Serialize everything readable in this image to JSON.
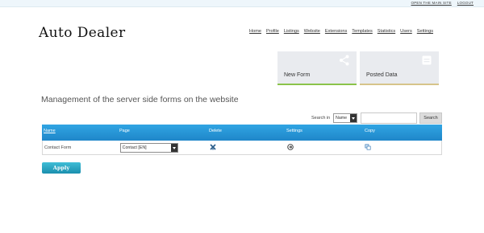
{
  "toplinks": {
    "main_site": "OPEN THE MAIN SITE",
    "logout": "LOGOUT"
  },
  "logo": "Auto Dealer",
  "nav": [
    "Home",
    "Profile",
    "Listings",
    "Website",
    "Extensions",
    "Templates",
    "Statistics",
    "Users",
    "Settings"
  ],
  "tiles": [
    {
      "label": "New Form",
      "icon": "share-icon"
    },
    {
      "label": "Posted Data",
      "icon": "document-icon"
    }
  ],
  "heading": "Management of the server side forms on the website",
  "search": {
    "label": "Search in",
    "field_value": "Name",
    "input_value": "",
    "button": "Search"
  },
  "table": {
    "headers": [
      "Name",
      "Page",
      "Delete",
      "Settings",
      "Copy"
    ],
    "rows": [
      {
        "name": "Contact Form",
        "page": "Contact [EN]",
        "delete_icon": "delete-icon",
        "settings_icon": "arrow-circle-icon",
        "copy_icon": "copy-icon"
      }
    ]
  },
  "apply_label": "Apply",
  "colors": {
    "header_blue": "#1f86c9",
    "apply_teal": "#2aa6c4",
    "tile_green": "#8bc34a",
    "tile_gold": "#d6c48a"
  }
}
